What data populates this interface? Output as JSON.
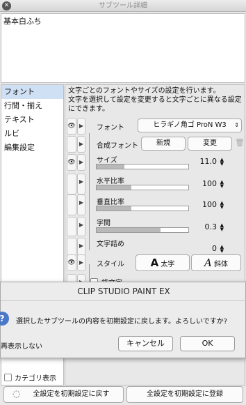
{
  "window": {
    "title": "サブツール詳細",
    "close_glyph": "✕"
  },
  "subtool_name": "基本白ふち",
  "categories": {
    "items": [
      {
        "label": "フォント"
      },
      {
        "label": "行間・揃え"
      },
      {
        "label": "テキスト"
      },
      {
        "label": "ルビ"
      },
      {
        "label": "編集設定"
      }
    ],
    "selected_index": 0,
    "show_category_label": "カテゴリ表示"
  },
  "description": {
    "line1": "文字ごとのフォントやサイズの設定を行います。",
    "line2": "文字を選択して設定を変更すると文字ごとに異なる設定",
    "line3": "にできます。"
  },
  "properties": {
    "font": {
      "label": "フォント",
      "value": "ヒラギノ角ゴ ProN W3"
    },
    "composite_font": {
      "label": "合成フォント",
      "new_label": "新規",
      "change_label": "変更"
    },
    "size": {
      "label": "サイズ",
      "value": "11.0",
      "fill": 0.3
    },
    "horizontal_scale": {
      "label": "水平比率",
      "value": "100",
      "fill": 0.38
    },
    "vertical_scale": {
      "label": "垂直比率",
      "value": "100",
      "fill": 0.38
    },
    "letter_spacing": {
      "label": "字間",
      "value": "0.3",
      "fill": 0.7
    },
    "char_tracking": {
      "label": "文字詰め",
      "value": "0"
    },
    "style": {
      "label": "スタイル",
      "bold_label": "太字",
      "italic_label": "斜体"
    },
    "outline_partial": {
      "label": "袋文字"
    }
  },
  "bottom": {
    "reset_all_label": "全設定を初期設定に戻す",
    "register_all_label": "全設定を初期設定に登録"
  },
  "dialog": {
    "title": "CLIP STUDIO PAINT EX",
    "message": "選択したサブツールの内容を初期設定に戻します。よろしいですか?",
    "dont_show_label": "再表示しない",
    "cancel_label": "キャンセル",
    "ok_label": "OK",
    "icon": "question-icon"
  }
}
